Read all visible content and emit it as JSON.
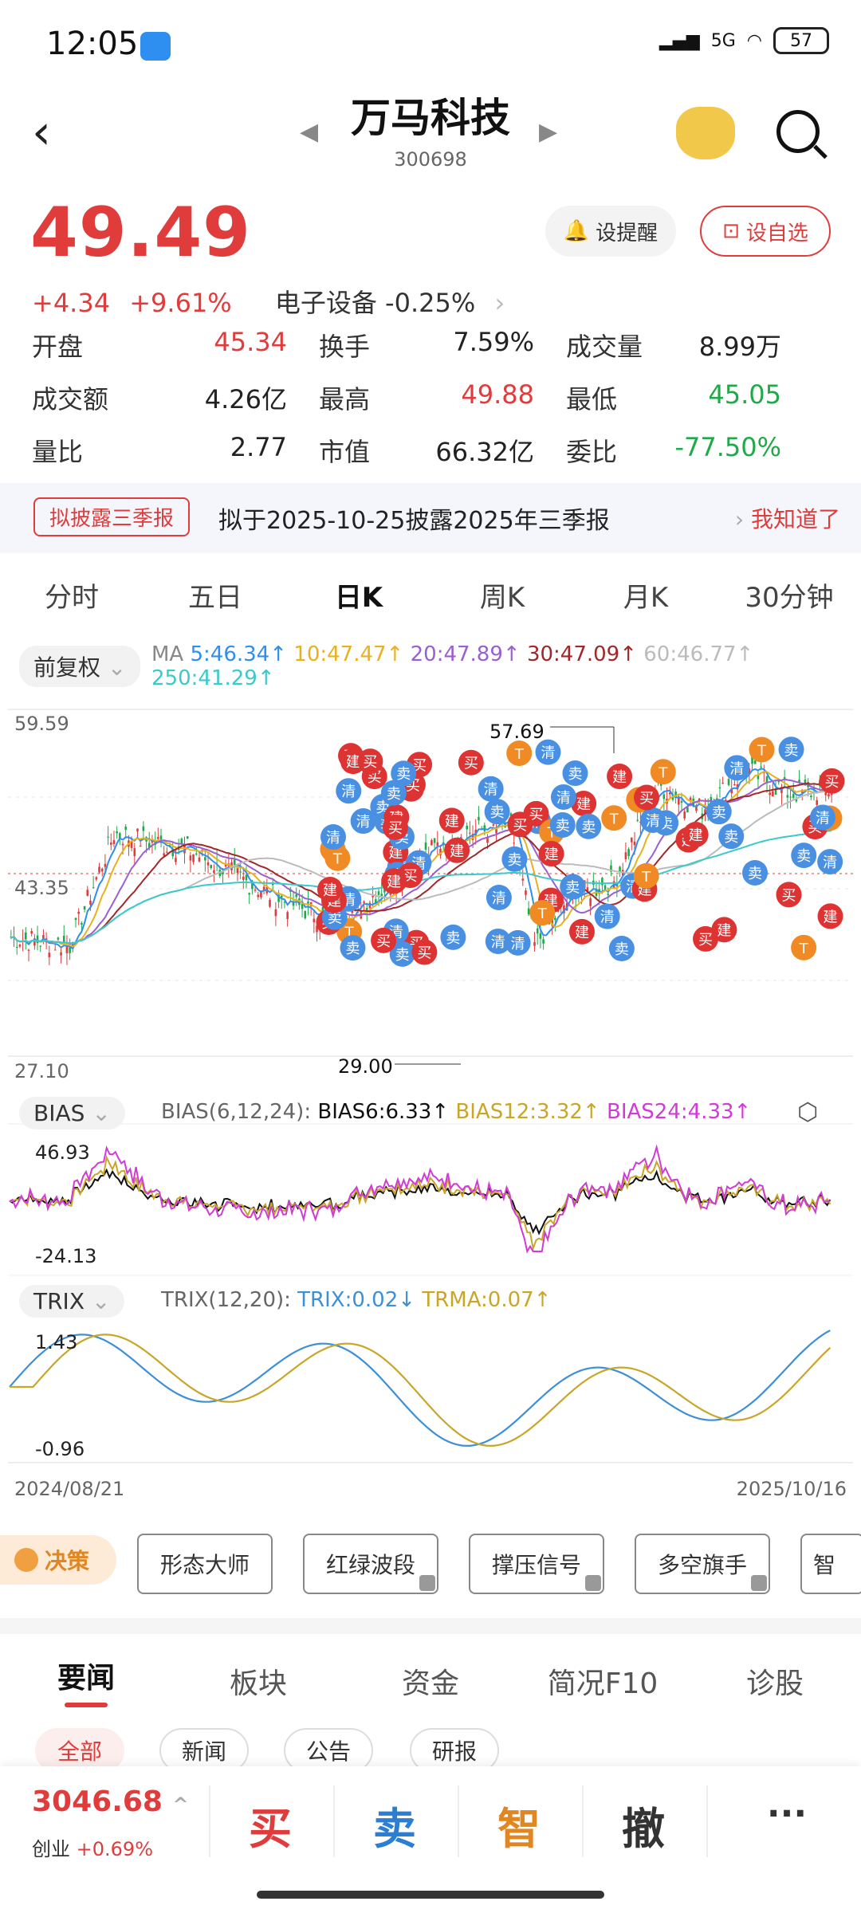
{
  "status": {
    "time": "12:05",
    "network": "5G",
    "battery": "57"
  },
  "header": {
    "title": "万马科技",
    "code": "300698"
  },
  "quote": {
    "price": "49.49",
    "change": "+4.34",
    "change_pct": "+9.61%",
    "sector": "电子设备 -0.25%",
    "alert_label": "设提醒",
    "watch_label": "设自选",
    "stats": [
      {
        "label": "开盘",
        "value": "45.34",
        "color": "red"
      },
      {
        "label": "换手",
        "value": "7.59%",
        "color": "black"
      },
      {
        "label": "成交量",
        "value": "8.99万",
        "color": "black"
      },
      {
        "label": "成交额",
        "value": "4.26亿",
        "color": "black"
      },
      {
        "label": "最高",
        "value": "49.88",
        "color": "red"
      },
      {
        "label": "最低",
        "value": "45.05",
        "color": "green"
      },
      {
        "label": "量比",
        "value": "2.77",
        "color": "black"
      },
      {
        "label": "市值",
        "value": "66.32亿",
        "color": "black"
      },
      {
        "label": "委比",
        "value": "-77.50%",
        "color": "green"
      }
    ]
  },
  "notice": {
    "tag": "拟披露三季报",
    "text": "拟于2025-10-25披露2025年三季报",
    "ok": "我知道了"
  },
  "period_tabs": [
    "分时",
    "五日",
    "日K",
    "周K",
    "月K",
    "30分钟"
  ],
  "kchart": {
    "adj_label": "前复权",
    "ma": {
      "title": "MA",
      "ma5": "5:46.34↑",
      "ma10": "10:47.47↑",
      "ma20": "20:47.89↑",
      "ma30": "30:47.09↑",
      "ma60": "60:46.77↑",
      "ma250": "250:41.29↑"
    },
    "y_top": "59.59",
    "y_mid": "43.35",
    "y_bot": "27.10",
    "high_label": "57.69",
    "low_label": "29.00",
    "bias": {
      "btn": "BIAS",
      "params": "BIAS(6,12,24):",
      "b6": "BIAS6:6.33↑",
      "b12": "BIAS12:3.32↑",
      "b24": "BIAS24:4.33↑",
      "y_top": "46.93",
      "y_bot": "-24.13"
    },
    "trix": {
      "btn": "TRIX",
      "params": "TRIX(12,20):",
      "trix": "TRIX:0.02↓",
      "trma": "TRMA:0.07↑",
      "y_top": "1.43",
      "y_bot": "-0.96"
    },
    "date_start": "2024/08/21",
    "date_end": "2025/10/16",
    "markers": [
      "清",
      "建",
      "卖",
      "买",
      "T"
    ]
  },
  "tools": {
    "decision": "决策",
    "items": [
      "形态大师",
      "红绿波段",
      "撑压信号",
      "多空旗手",
      "智"
    ]
  },
  "news_tabs": [
    "要闻",
    "板块",
    "资金",
    "简况F10",
    "诊股"
  ],
  "news_chips": [
    "全部",
    "新闻",
    "公告",
    "研报"
  ],
  "bottom": {
    "index_value": "3046.68",
    "index_name": "创业",
    "index_change": "+0.69%",
    "buy": "买",
    "sell": "卖",
    "smart": "智",
    "cancel": "撤",
    "more": "···"
  },
  "colors": {
    "up": "#e03c3c",
    "down": "#1faa4a",
    "ma5": "#2e8ff0",
    "ma10": "#e8b21e",
    "ma20": "#9a5fd0",
    "ma30": "#a02828",
    "ma60": "#bbbbbb",
    "ma250": "#3cc9c9"
  }
}
